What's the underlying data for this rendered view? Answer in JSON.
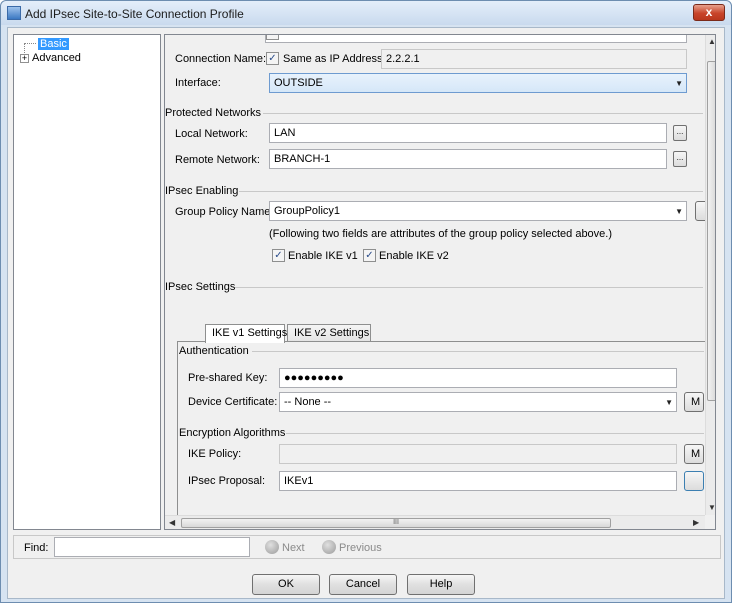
{
  "window": {
    "title": "Add IPsec Site-to-Site Connection Profile",
    "close_label": "x"
  },
  "tree": {
    "items": [
      {
        "label": "Basic",
        "selected": true
      },
      {
        "label": "Advanced",
        "expandable": true
      }
    ],
    "expander_glyph": "+"
  },
  "basic": {
    "connection_name_label": "Connection Name:",
    "same_as_ip_label": "Same as IP Address",
    "same_as_ip_checked": true,
    "connection_name_value": "2.2.2.1",
    "interface_label": "Interface:",
    "interface_value": "OUTSIDE"
  },
  "protected_networks": {
    "title": "Protected Networks",
    "local_label": "Local Network:",
    "local_value": "LAN",
    "remote_label": "Remote Network:",
    "remote_value": "BRANCH-1",
    "browse_glyph": "..."
  },
  "ipsec_enabling": {
    "title": "IPsec Enabling",
    "group_policy_label": "Group Policy Name:",
    "group_policy_value": "GroupPolicy1",
    "note": "(Following two fields are attributes of the group policy selected above.)",
    "enable_ikev1_label": "Enable IKE v1",
    "enable_ikev1_checked": true,
    "enable_ikev2_label": "Enable IKE v2",
    "enable_ikev2_checked": true
  },
  "ipsec_settings": {
    "title": "IPsec Settings",
    "tabs": [
      {
        "label": "IKE v1 Settings",
        "active": true
      },
      {
        "label": "IKE v2 Settings",
        "active": false
      }
    ],
    "authentication": {
      "title": "Authentication",
      "psk_label": "Pre-shared Key:",
      "psk_value": "●●●●●●●●●",
      "cert_label": "Device Certificate:",
      "cert_value": "-- None --",
      "cert_button_cut": "M"
    },
    "encryption": {
      "title": "Encryption Algorithms",
      "ike_policy_label": "IKE Policy:",
      "ike_policy_value": "",
      "ike_policy_button_cut": "M",
      "ipsec_proposal_label": "IPsec Proposal:",
      "ipsec_proposal_value": "IKEv1"
    }
  },
  "scroll": {
    "h_thumb_grip": "III"
  },
  "find": {
    "label": "Find:",
    "value": "",
    "next_label": "Next",
    "previous_label": "Previous"
  },
  "buttons": {
    "ok": "OK",
    "cancel": "Cancel",
    "help": "Help"
  }
}
